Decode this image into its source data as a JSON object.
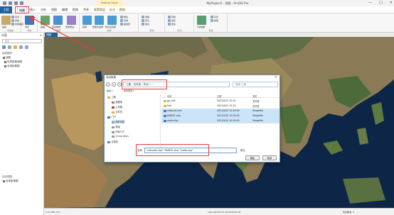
{
  "titlebar": {
    "context_tab": "Feature Layer",
    "title": "MyProject1 - 地图 - ArcGIS Pro",
    "min": "—",
    "max": "□",
    "close": "✕"
  },
  "ribbon_tabs": [
    "工程",
    "地图",
    "插入",
    "分析",
    "视图",
    "编辑",
    "影像",
    "共享",
    "要素图层",
    "标注",
    "数据"
  ],
  "ribbon": {
    "clipboard_label": "粘贴",
    "clipboard_small": [
      "剪切",
      "复制",
      "复制路径"
    ],
    "clipboard_group": "剪贴板",
    "nav_btn_label": "浏览",
    "nav_group": "导航",
    "layer_labels": [
      "底图",
      "添加数据",
      "添加预设"
    ],
    "layer_group": "图层",
    "select_labels": [
      "选择",
      "按属性选择",
      "按位置选择"
    ],
    "select_small": [
      "属性",
      "清除",
      "缩放至"
    ],
    "select_group": "选择",
    "inquiry_small": [
      "测量",
      "定位",
      "信息"
    ],
    "inquiry_group": "查询",
    "labeling_small": [
      "转换",
      "锁定",
      "更多"
    ],
    "labeling_group": "标注",
    "offline_labels": [
      "下载地图"
    ],
    "offline_small": [
      "同步",
      "移除"
    ],
    "offline_group": "离线"
  },
  "left_panel": {
    "title": "内容",
    "search_placeholder": "搜索",
    "section": "绘制顺序",
    "items": [
      "地图",
      "世界影像地图",
      "全球影像图"
    ],
    "section2": "标准视图",
    "items2": [
      "全球影像图"
    ]
  },
  "map_tab": "地图",
  "status_bar": {
    "scale": "1:37,685,725",
    "coords": "106.1467054°E 46.8330925°N",
    "selected": "所选要素: 0"
  },
  "dialog": {
    "title": "添加数据",
    "close": "✕",
    "back": "←",
    "forward": "→",
    "up": "↑",
    "breadcrumb": "工程  ›  文件夹  ›  作业一  ›",
    "search_placeholder": "搜索 工程",
    "toolbar": [
      "组织 ▾",
      "新建项目 ▾"
    ],
    "tree": [
      {
        "label": "工程",
        "indent": 0,
        "color": "#e0b14a"
      },
      {
        "label": "数据库",
        "indent": 1,
        "color": "#8a8a8a"
      },
      {
        "label": "工具箱",
        "indent": 1,
        "color": "#c0392b"
      },
      {
        "label": "文件夹",
        "indent": 1,
        "color": "#e0b14a"
      },
      {
        "label": "门户",
        "indent": 0,
        "color": "#3a7bd5"
      },
      {
        "label": "我的内容",
        "indent": 1,
        "color": "#999999"
      },
      {
        "label": "群组",
        "indent": 1,
        "color": "#999999"
      },
      {
        "label": "所有门户",
        "indent": 1,
        "color": "#999999"
      },
      {
        "label": "Living Atlas",
        "indent": 1,
        "color": "#999999"
      },
      {
        "label": "计算机",
        "indent": 0,
        "color": "#5b8cc0"
      }
    ],
    "columns": [
      "名称",
      "日期",
      "类型"
    ],
    "files": [
      {
        "name": "gp_info",
        "date": "2021/4/22 15:20",
        "type": "文件夹",
        "selected": false,
        "color": "#e0b14a"
      },
      {
        "name": "info",
        "date": "2021/4/22 15:20",
        "type": "文件夹",
        "selected": false,
        "color": "#e0b14a"
      },
      {
        "name": "natouzhi.shp",
        "date": "2021/5/20 10:29:45",
        "type": "Shapefile",
        "selected": true,
        "color": "#4a7ab5"
      },
      {
        "name": "PARCEL.shp",
        "date": "2021/5/20 10:29:45",
        "type": "Shapefile",
        "selected": true,
        "color": "#4a7ab5"
      },
      {
        "name": "audio.shp",
        "date": "2021/5/20 10:29:45",
        "type": "Shapefile",
        "selected": true,
        "color": "#4a7ab5"
      }
    ],
    "filename_label": "名称",
    "filename_value": "\"natouzhi.shp\" \"PARCEL.shp\" \"audio.shp\"",
    "filetype": "默认",
    "ok": "确定",
    "cancel": "取消"
  }
}
